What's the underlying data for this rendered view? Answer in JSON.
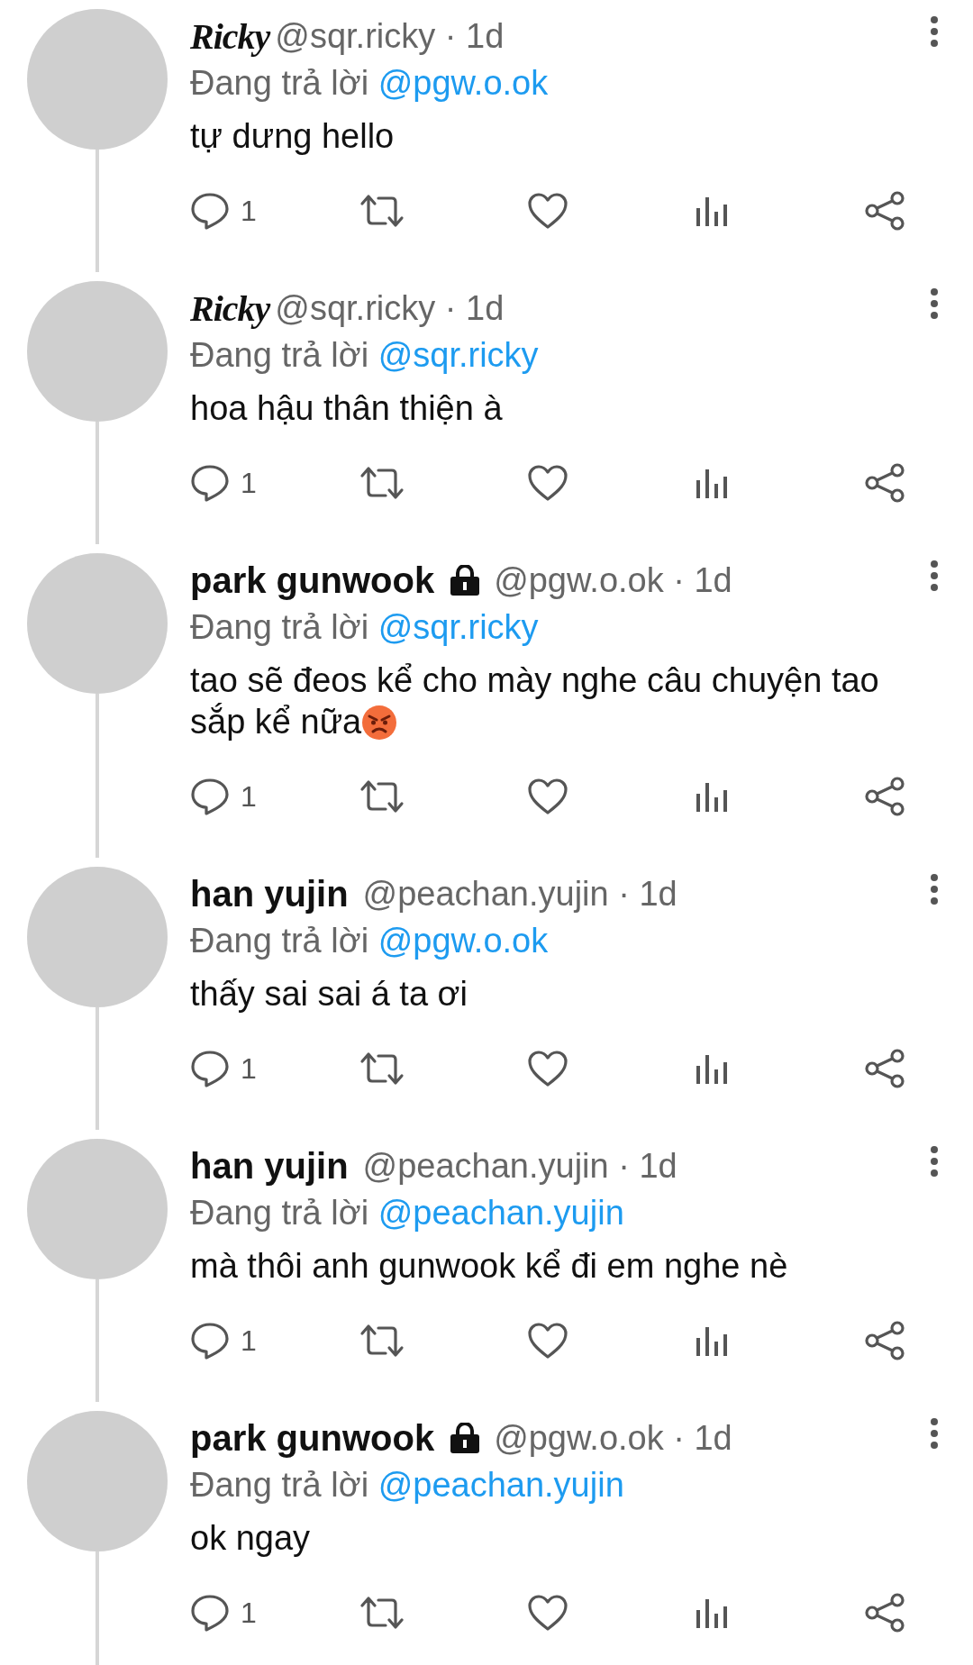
{
  "posts": [
    {
      "name": "Ricky",
      "kind": "script",
      "locked": false,
      "meta": "@sqr.ricky · 1d",
      "reply_prefix": "Đang trả lời",
      "reply_to": "@pgw.o.ok",
      "text": "tự dưng hello",
      "emoji": false,
      "reply_count": "1"
    },
    {
      "name": "Ricky",
      "kind": "script",
      "locked": false,
      "meta": "@sqr.ricky · 1d",
      "reply_prefix": "Đang trả lời",
      "reply_to": "@sqr.ricky",
      "text": "hoa hậu thân thiện à",
      "emoji": false,
      "reply_count": "1"
    },
    {
      "name": "park gunwook",
      "kind": "bold",
      "locked": true,
      "meta": "@pgw.o.ok · 1d",
      "reply_prefix": "Đang trả lời",
      "reply_to": "@sqr.ricky",
      "text": "tao sẽ đeos kể cho mày nghe câu chuyện tao sắp kể nữa",
      "emoji": true,
      "reply_count": "1"
    },
    {
      "name": "han yujin",
      "kind": "bold",
      "locked": false,
      "meta": "@peachan.yujin · 1d",
      "reply_prefix": "Đang trả lời",
      "reply_to": "@pgw.o.ok",
      "text": "thấy sai sai á ta ơi",
      "emoji": false,
      "reply_count": "1"
    },
    {
      "name": "han yujin",
      "kind": "bold",
      "locked": false,
      "meta": "@peachan.yujin · 1d",
      "reply_prefix": "Đang trả lời",
      "reply_to": "@peachan.yujin",
      "text": "mà thôi anh gunwook kể đi em nghe nè",
      "emoji": false,
      "reply_count": "1"
    },
    {
      "name": "park gunwook",
      "kind": "bold",
      "locked": true,
      "meta": "@pgw.o.ok · 1d",
      "reply_prefix": "Đang trả lời",
      "reply_to": "@peachan.yujin",
      "text": "ok ngay",
      "emoji": false,
      "reply_count": "1"
    }
  ]
}
